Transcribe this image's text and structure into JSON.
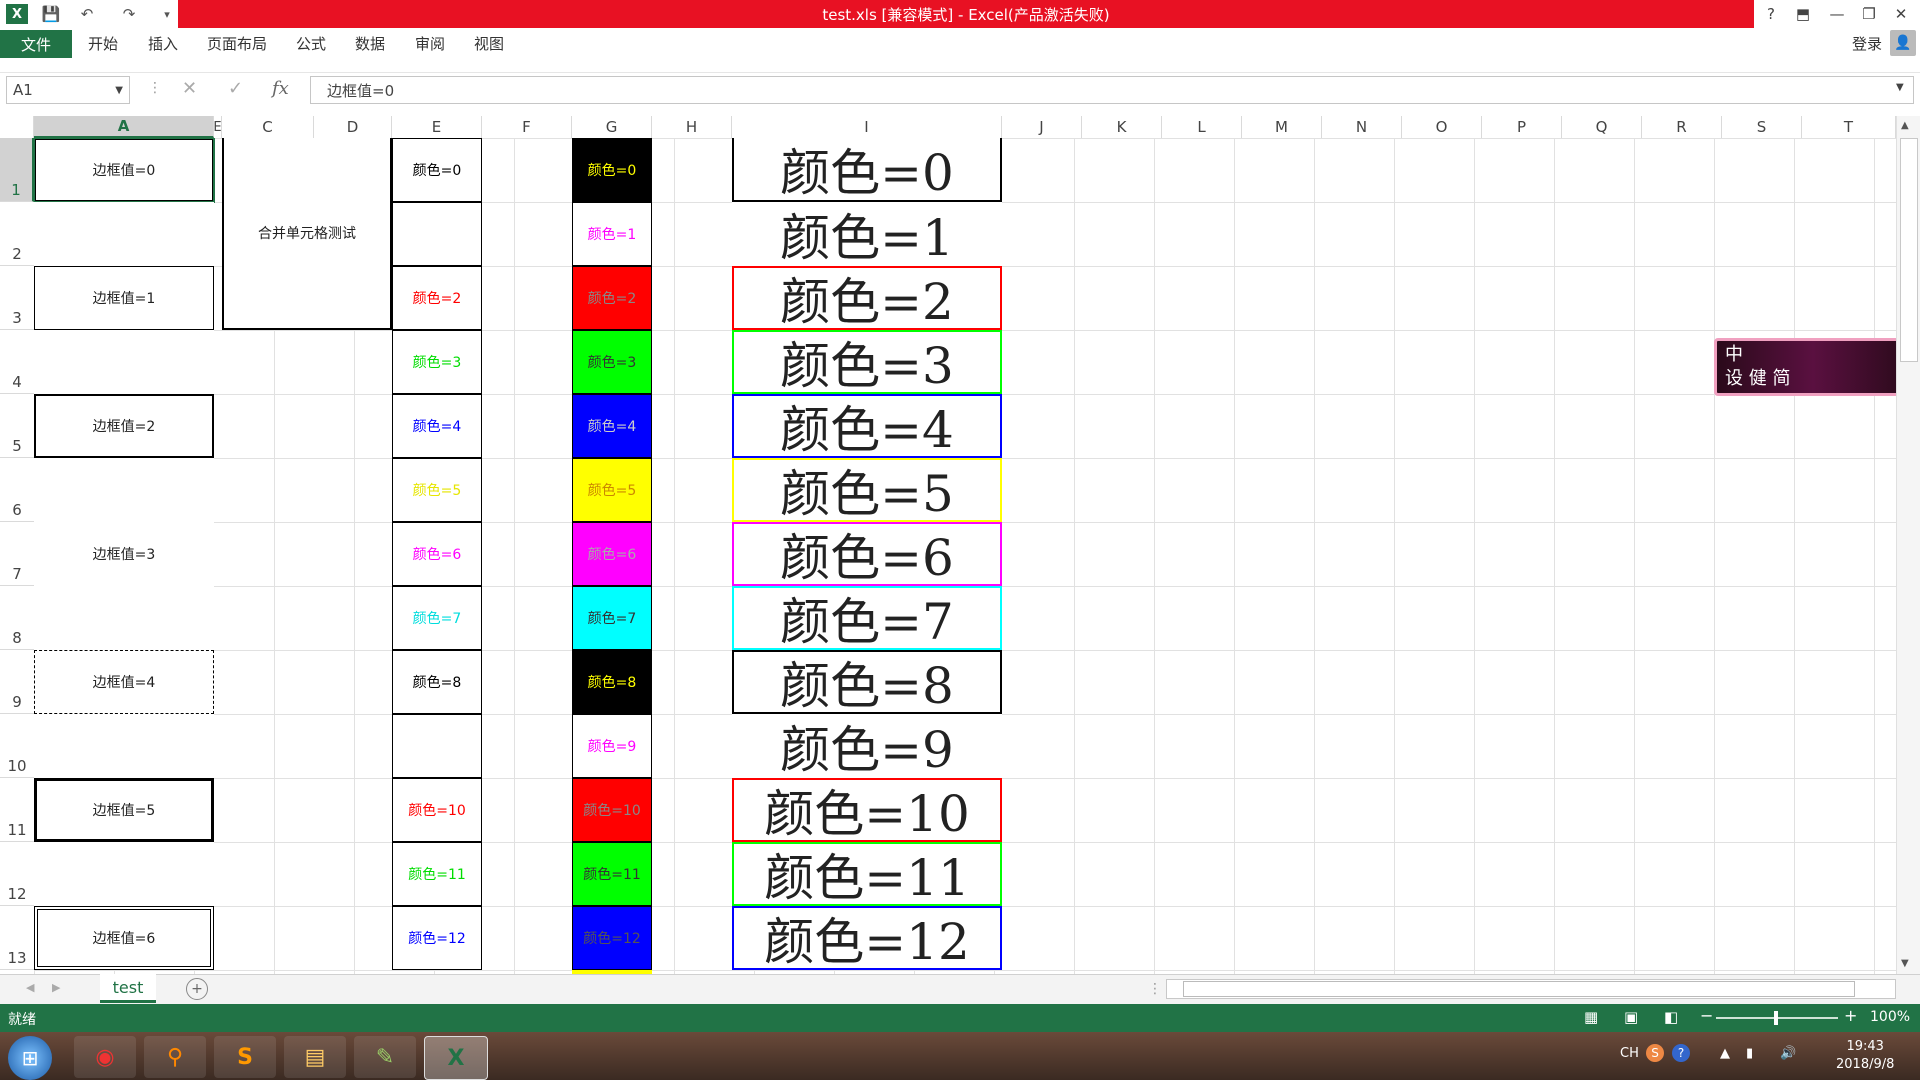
{
  "window": {
    "title": "test.xls  [兼容模式] -  Excel(产品激活失败)",
    "help_icon": "?",
    "login": "登录"
  },
  "ribbon": {
    "file_tab": "文件",
    "tabs": [
      "开始",
      "插入",
      "页面布局",
      "公式",
      "数据",
      "审阅",
      "视图"
    ]
  },
  "formula_bar": {
    "name_box": "A1",
    "formula": "边框值=0",
    "fx_label": "fx"
  },
  "columns": [
    "A",
    "E",
    "C",
    "D",
    "E",
    "F",
    "G",
    "H",
    "I",
    "J",
    "K",
    "L",
    "M",
    "N",
    "O",
    "P",
    "Q",
    "R",
    "S",
    "T"
  ],
  "rows": [
    "1",
    "2",
    "3",
    "4",
    "5",
    "6",
    "7",
    "8",
    "9",
    "10",
    "11",
    "12",
    "13"
  ],
  "cells": {
    "a1": "边框值=0",
    "a3": "边框值=1",
    "a5": "边框值=2",
    "a7": "边框值=3",
    "a9": "边框值=4",
    "a11": "边框值=5",
    "a13": "边框值=6",
    "merged": "合并单元格测试",
    "e_col": [
      "颜色=0",
      "",
      "颜色=2",
      "颜色=3",
      "颜色=4",
      "颜色=5",
      "颜色=6",
      "颜色=7",
      "颜色=8",
      "",
      "颜色=10",
      "颜色=11",
      "颜色=12"
    ],
    "g_col": [
      "颜色=0",
      "颜色=1",
      "颜色=2",
      "颜色=3",
      "颜色=4",
      "颜色=5",
      "颜色=6",
      "颜色=7",
      "颜色=8",
      "颜色=9",
      "颜色=10",
      "颜色=11",
      "颜色=12"
    ],
    "i_col": [
      "颜色=0",
      "颜色=1",
      "颜色=2",
      "颜色=3",
      "颜色=4",
      "颜色=5",
      "颜色=6",
      "颜色=7",
      "颜色=8",
      "颜色=9",
      "颜色=10",
      "颜色=11",
      "颜色=12"
    ]
  },
  "palette": {
    "c0": "#000000",
    "c1": "#ffffff",
    "c2": "#ff0000",
    "c3": "#00ff00",
    "c4": "#0000ff",
    "c5": "#ffff00",
    "c6": "#ff00ff",
    "c7": "#00ffff",
    "c8": "#000000",
    "c9": "#ffffff",
    "c10": "#ff0000",
    "c11": "#00ff00",
    "c12": "#0000ff",
    "excel_green": "#217346",
    "title_red": "#e81123"
  },
  "sheet_tab": "test",
  "status": {
    "ready": "就绪",
    "zoom": "100%"
  },
  "taskbar": {
    "ime": "CH",
    "time": "19:43",
    "date": "2018/9/8"
  },
  "overlay_badge": {
    "line1": "中",
    "line2": "设 健 简"
  }
}
